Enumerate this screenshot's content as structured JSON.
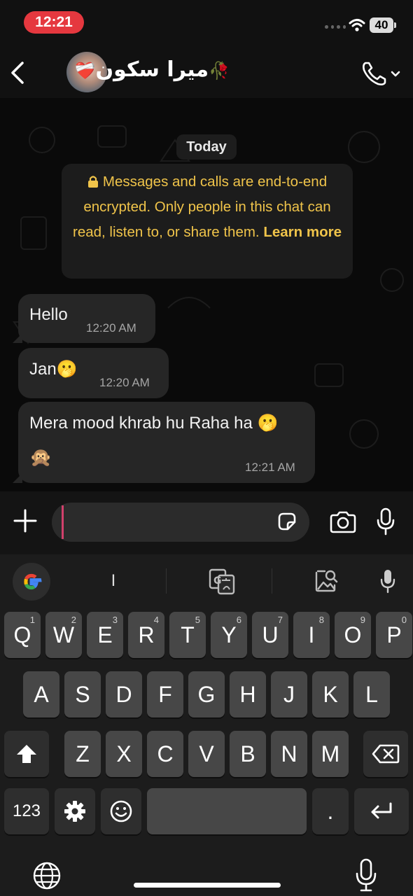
{
  "status_bar": {
    "time": "12:21",
    "battery": "40"
  },
  "header": {
    "contact_name": "ميرا سکون",
    "name_emoji_left": "❤️‍🩹",
    "name_emoji_right": "🥀"
  },
  "chat": {
    "date_chip": "Today",
    "encryption_notice": {
      "text": "Messages and calls are end-to-end encrypted. Only people in this chat can read, listen to, or share them.",
      "link": "Learn more"
    },
    "messages": [
      {
        "text": "Hello",
        "time": "12:20 AM"
      },
      {
        "text": "Jan",
        "emoji": "🫢",
        "time": "12:20 AM"
      },
      {
        "text": "Mera mood khrab hu Raha ha",
        "emoji": "🫢",
        "emoji2": "🙊",
        "time": "12:21 AM"
      }
    ]
  },
  "input": {
    "placeholder": ""
  },
  "keyboard": {
    "suggestion": "I",
    "row1": [
      {
        "k": "Q",
        "n": "1"
      },
      {
        "k": "W",
        "n": "2"
      },
      {
        "k": "E",
        "n": "3"
      },
      {
        "k": "R",
        "n": "4"
      },
      {
        "k": "T",
        "n": "5"
      },
      {
        "k": "Y",
        "n": "6"
      },
      {
        "k": "U",
        "n": "7"
      },
      {
        "k": "I",
        "n": "8"
      },
      {
        "k": "O",
        "n": "9"
      },
      {
        "k": "P",
        "n": "0"
      }
    ],
    "row2": [
      "A",
      "S",
      "D",
      "F",
      "G",
      "H",
      "J",
      "K",
      "L"
    ],
    "row3": [
      "Z",
      "X",
      "C",
      "V",
      "B",
      "N",
      "M"
    ],
    "num_key": "123",
    "period_key": "."
  }
}
